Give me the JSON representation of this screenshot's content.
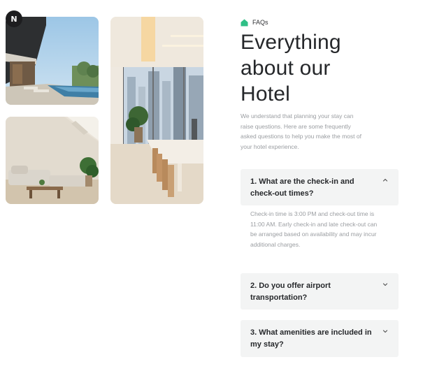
{
  "brand": {
    "logo_letter": "N"
  },
  "faq": {
    "eyebrow": "FAQs",
    "heading_line1": "Everything",
    "heading_line2": "about our",
    "heading_line3": "Hotel",
    "intro": "We understand that planning your stay can raise questions. Here are some frequently asked questions to help you make the most of your hotel experience.",
    "accent_color": "#2fbf86",
    "items": [
      {
        "question": "1. What are the check-in and check-out times?",
        "answer": "Check-in time is 3:00 PM and check-out time is 11:00 AM. Early check-in and late check-out can be arranged based on availability and may incur additional charges.",
        "expanded": true,
        "icon": "chevron-up-icon"
      },
      {
        "question": "2. Do you offer airport transportation?",
        "expanded": false,
        "icon": "chevron-down-icon"
      },
      {
        "question": "3. What amenities are included in my stay?",
        "expanded": false,
        "icon": "chevron-down-icon"
      }
    ]
  }
}
